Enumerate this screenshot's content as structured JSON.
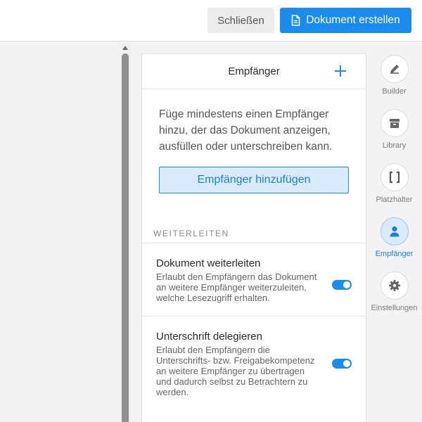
{
  "toolbar": {
    "close_label": "Schließen",
    "create_label": "Dokument erstellen"
  },
  "panel": {
    "title": "Empfänger",
    "intro": "Füge mindestens einen Empfänger hinzu, der das Dokument anzeigen, ausfüllen oder unterschreiben kann.",
    "add_button": "Empfänger hinzufügen",
    "section_label": "WEITERLEITEN",
    "settings": [
      {
        "title": "Dokument weiterleiten",
        "description": "Erlaubt den Empfängern das Dokument an weitere Empfänger weiterzuleiten, welche Lesezugriff erhalten.",
        "enabled": true
      },
      {
        "title": "Unterschrift delegieren",
        "description": "Erlaubt den Empfängern die Unterschrifts- bzw. Freigabekompetenz an weitere Empfänger zu übertragen und dadurch selbst zu Betrachtern zu werden.",
        "enabled": true
      }
    ]
  },
  "rail": {
    "items": [
      {
        "label": "Builder",
        "icon": "pencil-icon",
        "active": false
      },
      {
        "label": "Library",
        "icon": "archive-box-icon",
        "active": false
      },
      {
        "label": "Platzhalter",
        "icon": "brackets-icon",
        "active": false
      },
      {
        "label": "Empfänger",
        "icon": "user-icon",
        "active": true
      },
      {
        "label": "Einstellungen",
        "icon": "gear-icon",
        "active": false
      }
    ]
  },
  "colors": {
    "accent": "#1a8cf0",
    "accent_light": "#d9ebfd",
    "background": "#f3f3f3"
  }
}
